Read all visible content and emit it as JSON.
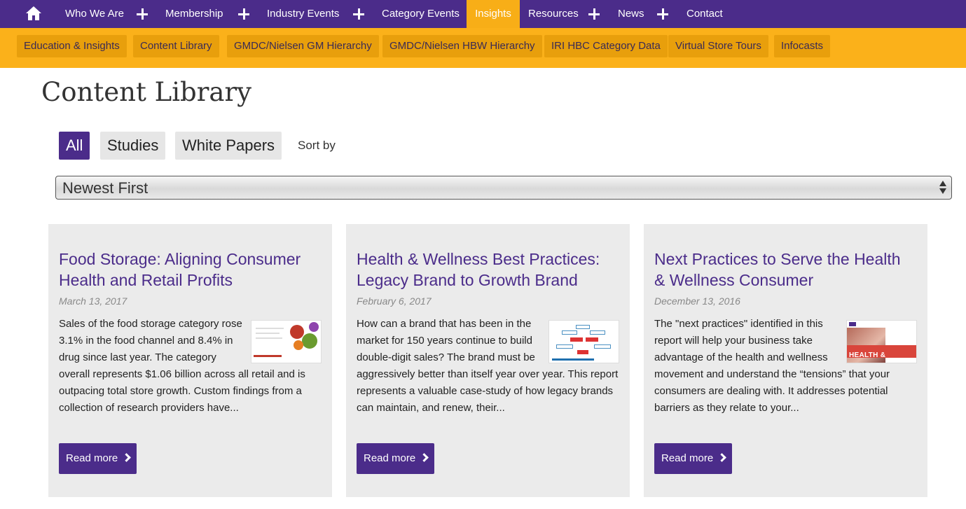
{
  "nav": {
    "home_icon": "home-icon",
    "items": [
      "Who We Are",
      "Membership",
      "Industry Events",
      "Category Events",
      "Insights",
      "Resources",
      "News",
      "Contact"
    ],
    "active": "Insights"
  },
  "subnav": {
    "items": [
      "Education & Insights",
      "Content Library",
      "GMDC/Nielsen GM Hierarchy",
      "GMDC/Nielsen HBW Hierarchy",
      "IRI HBC Category Data",
      "Virtual Store Tours",
      "Infocasts"
    ]
  },
  "page": {
    "title": "Content Library"
  },
  "filters": {
    "items": [
      "All",
      "Studies",
      "White Papers"
    ],
    "active": "All",
    "sort_label": "Sort by",
    "sort_value": "Newest First"
  },
  "cards": [
    {
      "title": "Food Storage: Aligning Consumer Health and Retail Profits",
      "date": "March 13, 2017",
      "excerpt": "Sales of the food storage category rose 3.1% in the food channel and 8.4% in drug since last year. The category overall represents $1.06 billion across all retail and is outpacing total store growth. Custom findings from a collection of research providers have...",
      "read_more": "Read more"
    },
    {
      "title": "Health & Wellness Best Practices: Legacy Brand to Growth Brand",
      "date": "February 6, 2017",
      "excerpt": "How can a brand that has been in the market for 150 years continue to build double-digit sales? The brand must be aggressively better than itself year over year. This report represents a valuable case-study of how legacy brands can maintain, and renew, their...",
      "read_more": "Read more"
    },
    {
      "title": "Next Practices to Serve the Health & Wellness Consumer",
      "date": "December 13, 2016",
      "excerpt": "The \"next practices\" identified in this report will help your business take advantage of the health and wellness movement and understand the “tensions” that your consumers are dealing with. It addresses potential barriers as they relate to your...",
      "read_more": "Read more"
    }
  ],
  "colors": {
    "brand_purple": "#4b2c8a",
    "brand_yellow": "#fbb11a",
    "card_bg": "#ebebeb"
  }
}
